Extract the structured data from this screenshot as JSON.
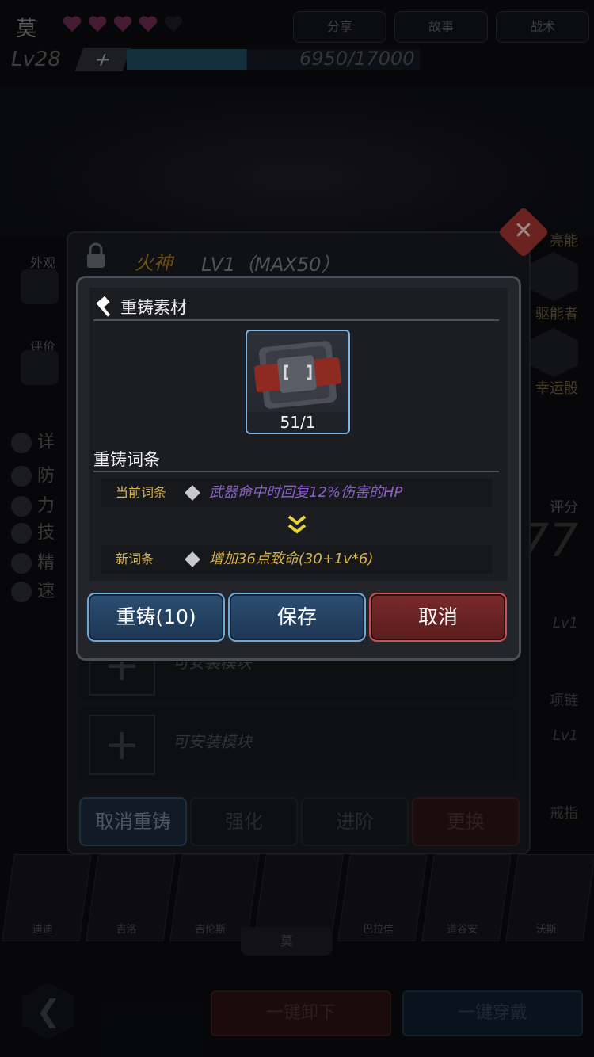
{
  "header": {
    "hero_name": "莫",
    "hearts_filled": 4,
    "level": "Lv28",
    "xp_plus": "+",
    "xp_text": "6950/17000",
    "xp_progress": 0.41,
    "tabs": [
      "分享",
      "故事",
      "战术"
    ]
  },
  "side_left": {
    "appearance": "外观",
    "review": "评价",
    "menu": [
      "详",
      "防",
      "力",
      "技",
      "精",
      "速"
    ]
  },
  "side_right": {
    "items": [
      "亮能",
      "驱能者",
      "幸运骰"
    ],
    "score_label": "评分",
    "score_value": "77",
    "slot1_level": "Lv1",
    "slot1_name": "项链",
    "slot2_level": "Lv1",
    "slot2_name": "戒指"
  },
  "panel": {
    "title": "火神",
    "level": "LV1（MAX50）",
    "modules": [
      "可安装模块",
      "可安装模块"
    ],
    "bottom_buttons": [
      "取消重铸",
      "强化",
      "进阶",
      "更换"
    ]
  },
  "portraits": [
    "迪迪",
    "吉洛",
    "吉伦斯",
    "",
    "巴拉信",
    "道谷安",
    "沃斯"
  ],
  "selected_hero_tab": "莫",
  "footer": {
    "back_icon": "chevron-left-icon",
    "unequip_all": "一键卸下",
    "equip_all": "一键穿戴"
  },
  "dialog": {
    "material_title": "重铸素材",
    "material_count": "51/1",
    "affix_title": "重铸词条",
    "current_label": "当前词条",
    "current_text": "武器命中时回复12%伤害的HP",
    "new_label": "新词条",
    "new_text": "增加36点致命(30+1v*6)",
    "buttons": {
      "reforge": "重铸(10)",
      "save": "保存",
      "cancel": "取消"
    },
    "colors": {
      "current_text": "#8b5fc7",
      "new_text": "#d6b24a",
      "accent_blue": "#6aa9d8",
      "accent_red": "#c45454"
    }
  }
}
